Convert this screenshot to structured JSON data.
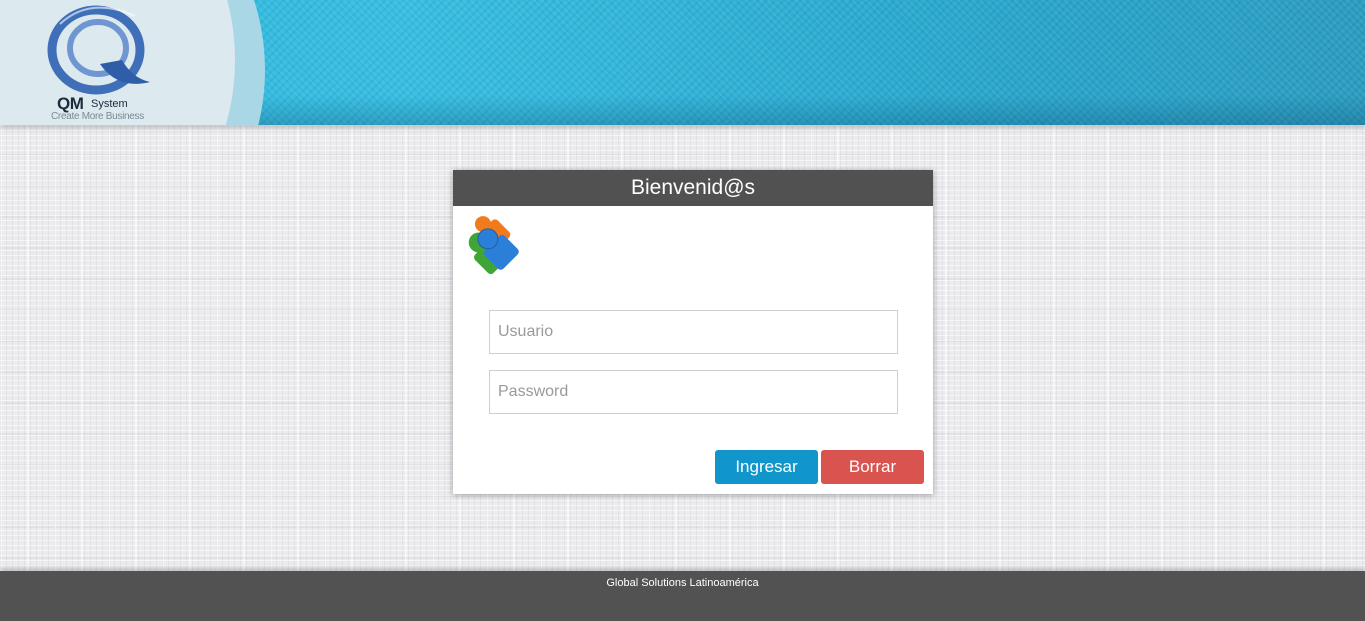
{
  "header": {
    "logo": {
      "brand": "QM",
      "brand_suffix": "System",
      "tagline": "Create More Business"
    }
  },
  "login": {
    "title": "Bienvenid@s",
    "icon": "users-icon",
    "username": {
      "placeholder": "Usuario",
      "value": ""
    },
    "password": {
      "placeholder": "Password",
      "value": ""
    },
    "submit_label": "Ingresar",
    "clear_label": "Borrar"
  },
  "footer": {
    "text": "Global Solutions Latinoamérica"
  },
  "colors": {
    "header_blue": "#37bfe3",
    "card_header": "#515151",
    "submit_button": "#1196cc",
    "clear_button": "#d9534f",
    "footer": "#525252"
  }
}
